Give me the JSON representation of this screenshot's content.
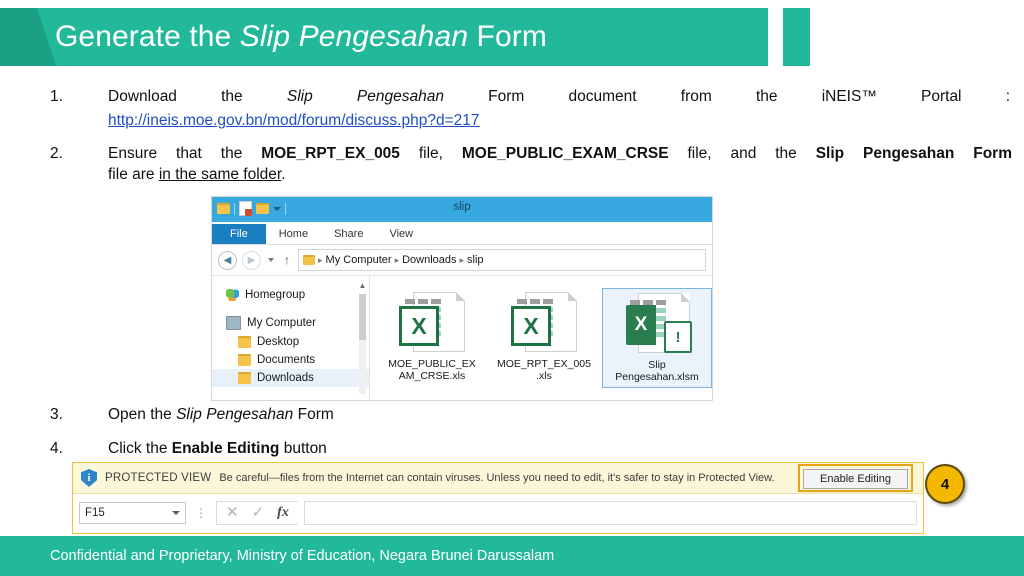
{
  "slide": {
    "title_plain_1": "Generate the ",
    "title_italic": "Slip Pengesahan",
    "title_plain_2": " Form",
    "accent_teal": "#22b99b",
    "accent_teal_dark": "#1ba084",
    "link_color": "#1f4fc4",
    "callout_color": "#f5b800"
  },
  "steps": [
    {
      "number": "1.",
      "text_before_italic": "Download the ",
      "italic": "Slip Pengesahan",
      "text_after_italic": " Form document from the iNEIS™ Portal :",
      "url": "http://ineis.moe.gov.bn/mod/forum/discuss.php?d=217"
    },
    {
      "number": "2.",
      "p1": "Ensure that the ",
      "bold1": "MOE_RPT_EX_005",
      "p2": " file, ",
      "bold2": "MOE_PUBLIC_EXAM_CRSE",
      "p3": " file, and the ",
      "bold3": "Slip Pengesahan Form",
      "p4": " file are ",
      "underline": "in the same folder",
      "p5": "."
    },
    {
      "number": "3.",
      "text_before_italic": "Open the ",
      "italic": "Slip Pengesahan",
      "text_after_italic": " Form"
    },
    {
      "number": "4.",
      "text_before_bold": "Click the ",
      "bold": "Enable Editing",
      "text_after_bold": " button"
    }
  ],
  "explorer": {
    "window_title": "slip",
    "ribbon_tabs": [
      "File",
      "Home",
      "Share",
      "View"
    ],
    "breadcrumb": [
      "My Computer",
      "Downloads",
      "slip"
    ],
    "breadcrumb_separator": "▸",
    "sidebar": [
      {
        "label": "Homegroup",
        "icon": "homegroup-icon",
        "indent": false
      },
      {
        "label": "My Computer",
        "icon": "computer-icon",
        "indent": false
      },
      {
        "label": "Desktop",
        "icon": "folder-icon",
        "indent": true
      },
      {
        "label": "Documents",
        "icon": "folder-icon",
        "indent": true
      },
      {
        "label": "Downloads",
        "icon": "folder-icon",
        "indent": true,
        "selected": true
      }
    ],
    "files": [
      {
        "name_line1": "MOE_PUBLIC_EX",
        "name_line2": "AM_CRSE.xls",
        "type": "xls",
        "selected": false
      },
      {
        "name_line1": "MOE_RPT_EX_005",
        "name_line2": ".xls",
        "type": "xls",
        "selected": false
      },
      {
        "name_line1": "Slip",
        "name_line2": "Pengesahan.xlsm",
        "type": "xlsm",
        "selected": true
      }
    ],
    "xls_badge_letter": "X",
    "xlsm_badge_letter": "X",
    "macro_glyph": "!"
  },
  "excel": {
    "protected_view": {
      "shield_glyph": "i",
      "label": "PROTECTED VIEW",
      "message": "Be careful—files from the Internet can contain viruses. Unless you need to edit, it's safer to stay in Protected View.",
      "button_label": "Enable Editing"
    },
    "formula_bar": {
      "name_box_value": "F15",
      "cancel_glyph": "✕",
      "confirm_glyph": "✓",
      "function_glyph": "fx",
      "formula_value": ""
    }
  },
  "callout": {
    "number": "4"
  },
  "footer": {
    "text": "Confidential and Proprietary, Ministry of Education, Negara Brunei Darussalam"
  }
}
